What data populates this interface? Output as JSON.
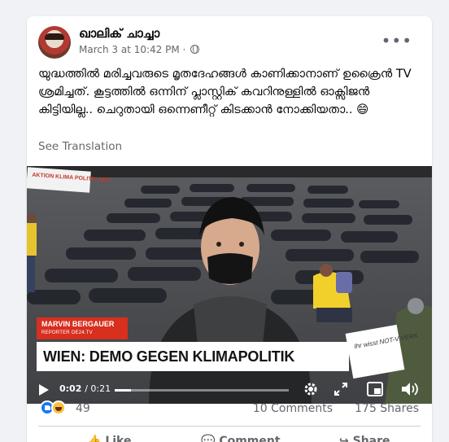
{
  "post": {
    "author": "ഖാലിക് ചാച്ചാ",
    "timestamp": "March 3 at 10:42 PM",
    "dot": "·",
    "text": "യുദ്ധത്തിൽ മരിച്ചവരുടെ മൃതദേഹങ്ങൾ കാണിക്കാനാണ് ഉക്രൈൻ TV ശ്രമിച്ചത്. കൂട്ടത്തിൽ ഒന്നിന് പ്ലാസ്റ്റിക് കവറിനുള്ളിൽ ഓക്സിജൻ കിട്ടിയില്ല.. ചെറുതായി ഒന്നെണീറ്റ് കിടക്കാൻ നോക്കിയതാ.. 😄",
    "see_translation": "See Translation",
    "more_icon": "more-horizontal-icon",
    "privacy_icon": "globe-icon"
  },
  "video": {
    "lower_third_name": "MARVIN BERGAUER",
    "lower_third_role": "REPORTER OE24.TV",
    "headline": "WIEN: DEMO GEGEN KLIMAPOLITIK",
    "banner_text": "AKTION KLIMA POLITIK NEU",
    "sign_text": "Ihr wisst NOT-V VERK",
    "current_time": "0:02",
    "duration": "0:21",
    "progress": 0.095,
    "icons": [
      "play-icon",
      "settings-icon",
      "fullscreen-icon",
      "pip-icon",
      "volume-icon"
    ]
  },
  "engagement": {
    "reaction_count": "49",
    "comments": "10 Comments",
    "shares": "175 Shares",
    "reaction_icons": [
      "like-icon",
      "haha-icon"
    ]
  },
  "actions": {
    "like": "Like",
    "comment": "Comment",
    "share": "Share"
  },
  "colors": {
    "accent_blue": "#1877f2",
    "lower_third_red": "#d82f1e",
    "secondary_text": "#65676b"
  }
}
